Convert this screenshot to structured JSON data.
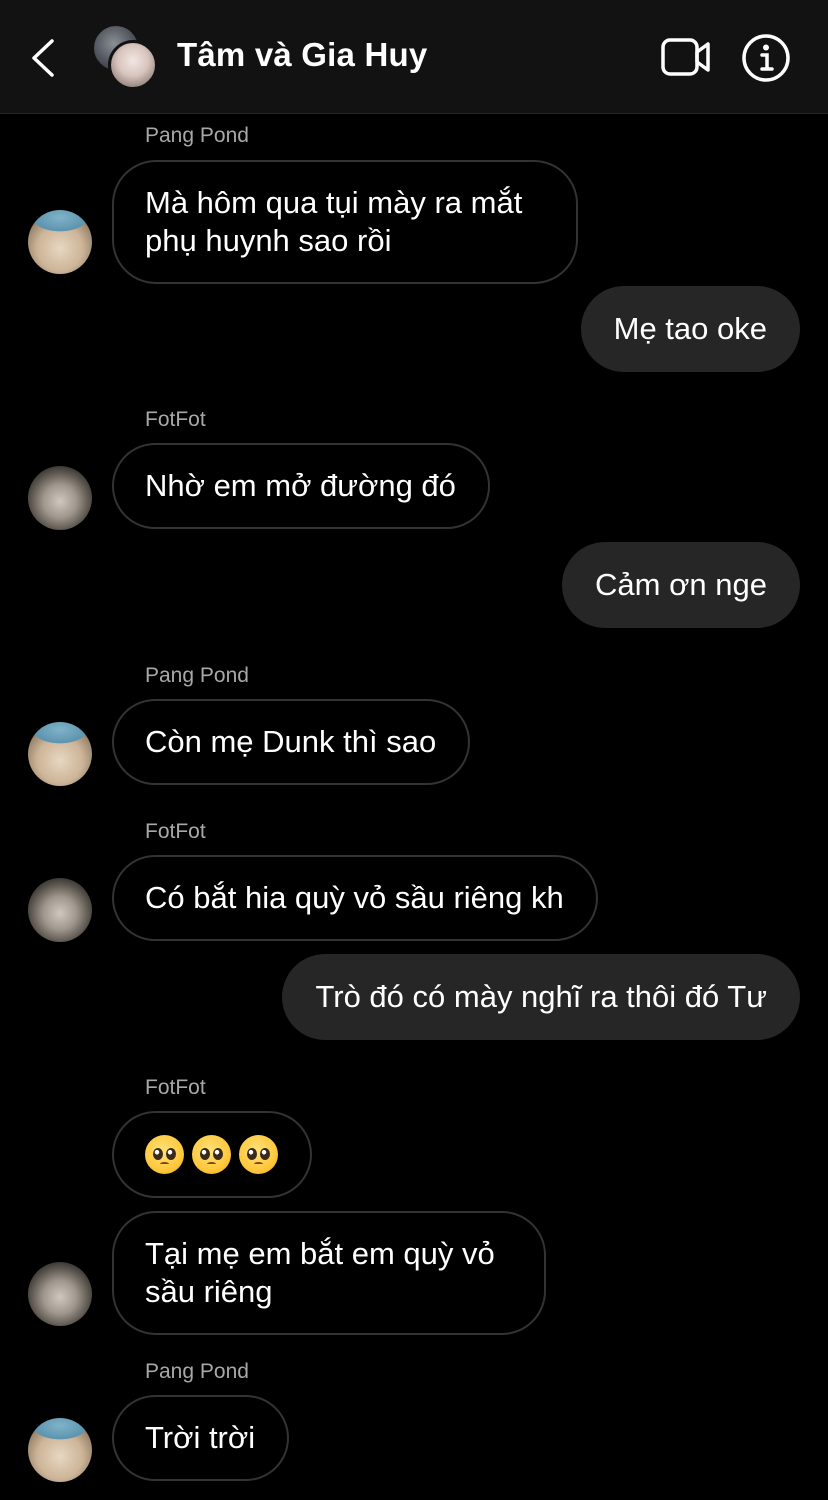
{
  "header": {
    "title": "Tâm và Gia Huy",
    "back_icon": "chevron-left-icon",
    "video_icon": "video-camera-icon",
    "info_icon": "info-circle-icon"
  },
  "colors": {
    "header_bg": "#121212",
    "incoming_bubble_border": "#333333",
    "outgoing_bubble_bg": "#262626",
    "sender_text": "#a8a8a8"
  },
  "messages": [
    {
      "sender": "Pang Pond",
      "text": "Mà hôm qua tụi mày ra mắt phụ huynh sao rồi"
    },
    {
      "sender": "me",
      "text": "Mẹ tao oke"
    },
    {
      "sender": "FotFot",
      "text": "Nhờ em mở đường đó"
    },
    {
      "sender": "me",
      "text": "Cảm ơn nge"
    },
    {
      "sender": "Pang Pond",
      "text": "Còn mẹ Dunk thì sao"
    },
    {
      "sender": "FotFot",
      "text": "Có bắt hia quỳ vỏ sầu riêng kh"
    },
    {
      "sender": "me",
      "text": "Trò đó có mày nghĩ ra thôi đó Tư"
    },
    {
      "sender": "FotFot",
      "text": "🥺🥺🥺",
      "emoji": "pleading-face",
      "emoji_count": 3
    },
    {
      "sender": "FotFot",
      "text": "Tại mẹ em bắt em quỳ vỏ sầu riêng"
    },
    {
      "sender": "Pang Pond",
      "text": "Trời trời"
    }
  ]
}
